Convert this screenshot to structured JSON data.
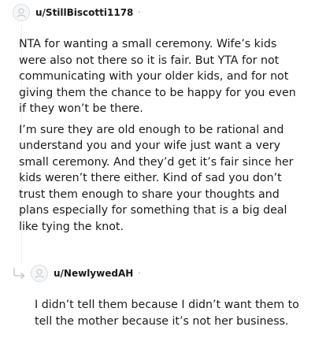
{
  "comments": [
    {
      "username": "u/StillBiscotti1178",
      "separator": "·",
      "paragraphs": [
        "NTA for wanting a small ceremony. Wife’s kids were also not there so it is fair. But YTA for not communicating with your older kids, and for not giving them the chance to be happy for you even if they won’t be there.",
        "I’m sure they are old enough to be rational and understand you and your wife just want a very small ceremony. And they’d get it’s fair since her kids weren’t there either. Kind of sad you don’t trust them enough to share your thoughts and plans especially for something that is a big deal like tying the knot."
      ]
    },
    {
      "username": "u/NewlywedAH",
      "separator": "·",
      "is_reply": true,
      "paragraphs": [
        "I didn’t tell them because I didn’t want them to tell the mother because it’s not her business."
      ]
    }
  ],
  "icons": {
    "avatar": "default-avatar-icon",
    "reply": "reply-arrow-icon"
  },
  "colors": {
    "text": "#1a1a1b",
    "meta": "#787c7e",
    "thread_line": "#edeff1"
  }
}
